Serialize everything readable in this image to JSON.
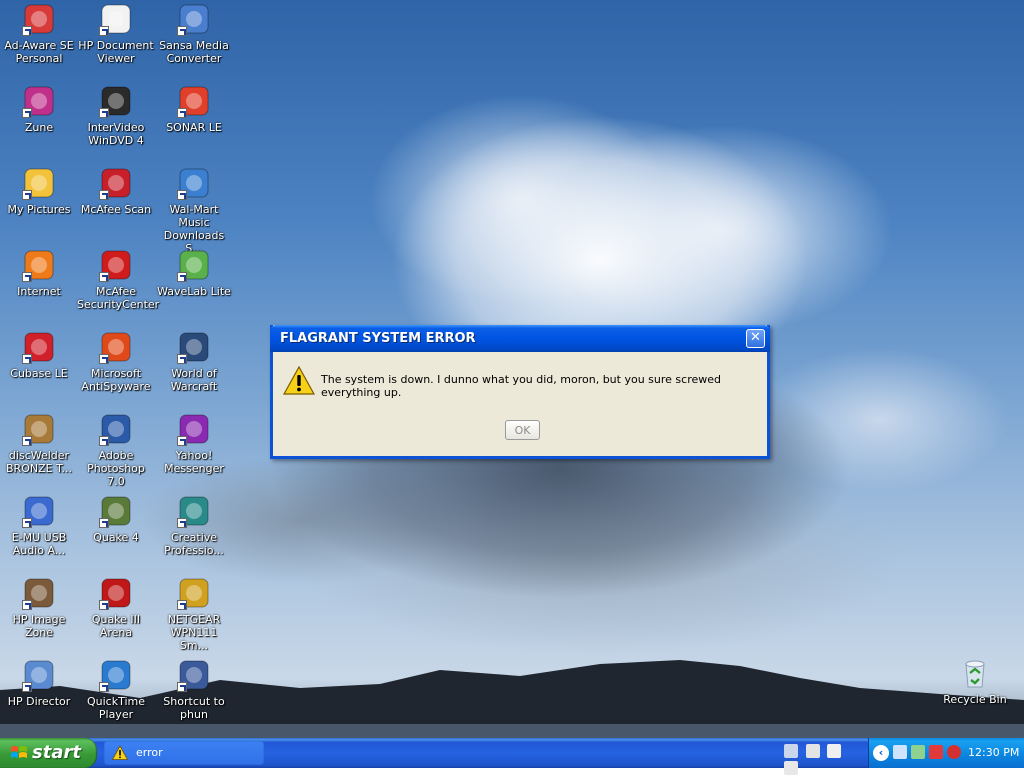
{
  "desktop": {
    "icons": [
      {
        "label": "Ad-Aware SE\nPersonal",
        "icon": "ad-aware-icon"
      },
      {
        "label": "HP Document\nViewer",
        "icon": "hp-document-icon"
      },
      {
        "label": "Sansa Media\nConverter",
        "icon": "sansa-icon"
      },
      {
        "label": "Zune",
        "icon": "zune-icon"
      },
      {
        "label": "InterVideo\nWinDVD 4",
        "icon": "windvd-icon"
      },
      {
        "label": "SONAR LE",
        "icon": "sonar-icon"
      },
      {
        "label": "My Pictures",
        "icon": "my-pictures-icon"
      },
      {
        "label": "McAfee Scan",
        "icon": "mcafee-scan-icon"
      },
      {
        "label": "Wal-Mart Music\nDownloads S...",
        "icon": "walmart-music-icon"
      },
      {
        "label": "Internet",
        "icon": "firefox-icon"
      },
      {
        "label": "McAfee\nSecurityCenter",
        "icon": "mcafee-securitycenter-icon"
      },
      {
        "label": "WaveLab Lite",
        "icon": "wavelab-icon"
      },
      {
        "label": "Cubase LE",
        "icon": "cubase-icon"
      },
      {
        "label": "Microsoft\nAntiSpyware",
        "icon": "antispyware-icon"
      },
      {
        "label": "World of\nWarcraft",
        "icon": "wow-icon"
      },
      {
        "label": "discWelder\nBRONZE T...",
        "icon": "discwelder-icon"
      },
      {
        "label": "Adobe\nPhotoshop 7.0",
        "icon": "photoshop-icon"
      },
      {
        "label": "Yahoo!\nMessenger",
        "icon": "yahoo-messenger-icon"
      },
      {
        "label": "E-MU USB\nAudio A...",
        "icon": "emu-usb-icon"
      },
      {
        "label": "Quake 4",
        "icon": "quake4-icon"
      },
      {
        "label": "Creative\nProfessio...",
        "icon": "creative-icon"
      },
      {
        "label": "HP Image\nZone",
        "icon": "hp-image-zone-icon"
      },
      {
        "label": "Quake III\nArena",
        "icon": "quake3-icon"
      },
      {
        "label": "NETGEAR\nWPN111 Sm...",
        "icon": "netgear-icon"
      },
      {
        "label": "HP Director",
        "icon": "hp-director-icon"
      },
      {
        "label": "QuickTime\nPlayer",
        "icon": "quicktime-icon"
      },
      {
        "label": "Shortcut to\nphun",
        "icon": "shortcut-window-icon"
      }
    ],
    "recycle_bin": {
      "label": "Recycle Bin"
    }
  },
  "dialog": {
    "title": "FLAGRANT SYSTEM ERROR",
    "close_glyph": "✕",
    "message": "The system is down. I dunno what you did, moron, but you sure screwed everything up.",
    "ok_label": "OK"
  },
  "taskbar": {
    "start_label": "start",
    "tasks": [
      {
        "label": "error"
      }
    ],
    "tray_chevron": "‹",
    "clock": "12:30 PM"
  },
  "colors": {
    "titlebar": "#0054e3",
    "taskbar": "#2663e0",
    "start_button": "#379a37",
    "dialog_body": "#ece9d8"
  }
}
